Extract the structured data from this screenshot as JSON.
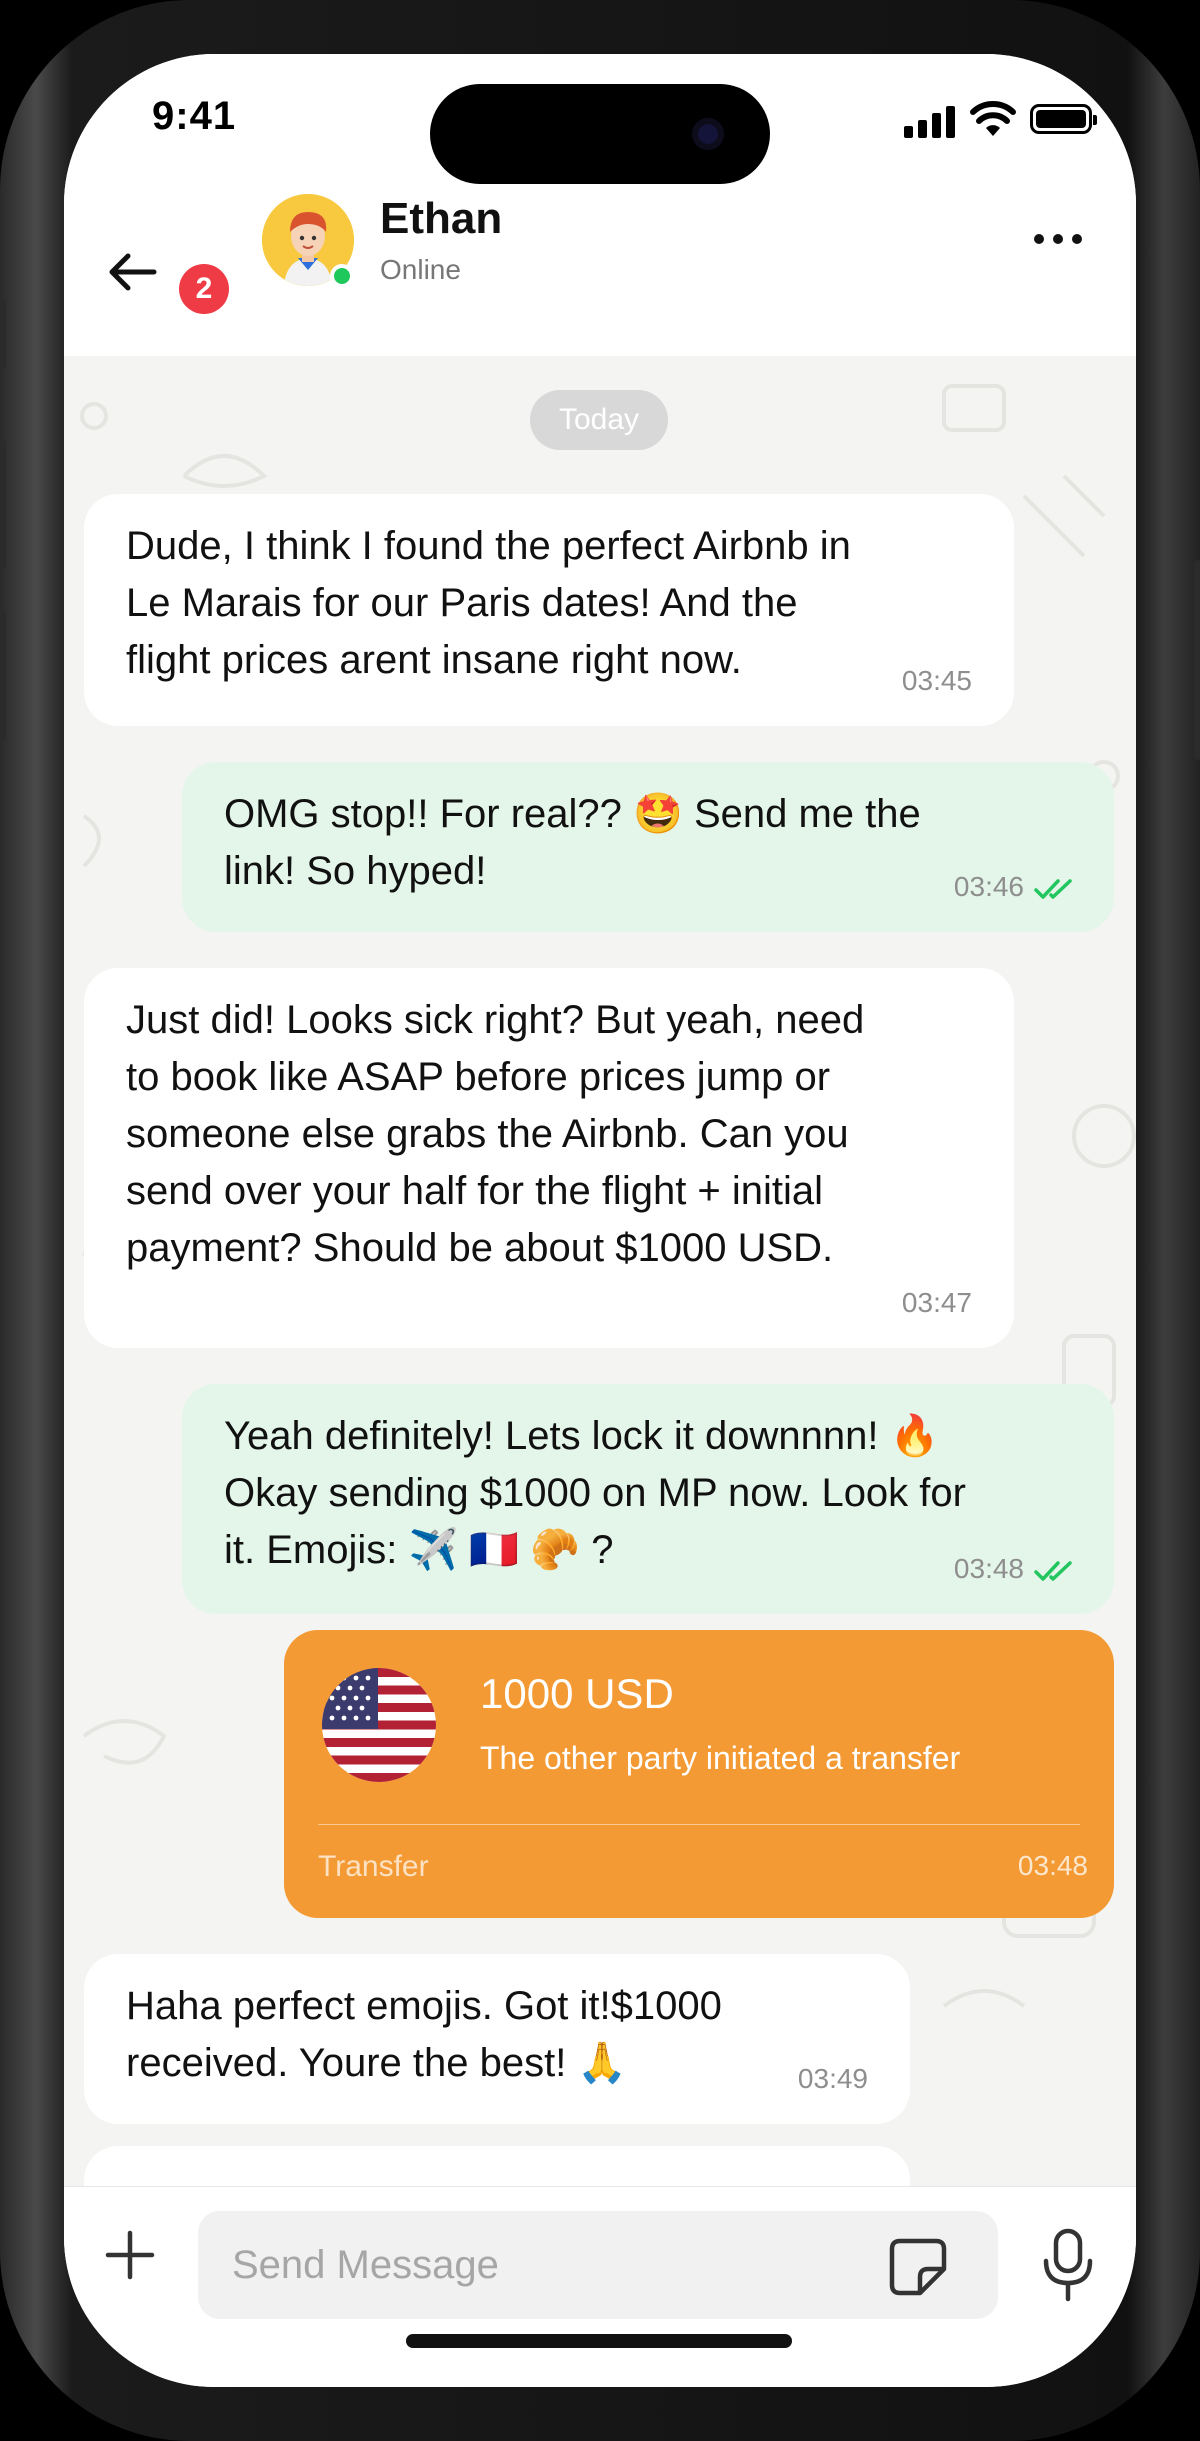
{
  "status_bar": {
    "time": "9:41"
  },
  "header": {
    "back_icon": "arrow-left-icon",
    "unread_count": "2",
    "contact_name": "Ethan",
    "contact_status": "Online",
    "more_icon": "more-horizontal-icon"
  },
  "chat": {
    "date_separator": "Today",
    "messages": [
      {
        "direction": "incoming",
        "text": "Dude, I think I found the perfect Airbnb in\nLe Marais for our Paris dates! And the\nflight prices arent insane right now.",
        "time": "03:45"
      },
      {
        "direction": "outgoing",
        "text": "OMG stop!! For real?? 🤩 Send me the\nlink! So hyped!",
        "time": "03:46",
        "read": true
      },
      {
        "direction": "incoming",
        "text": "Just did! Looks sick right? But yeah, need\nto book like ASAP before prices jump or\nsomeone else grabs the Airbnb. Can you\nsend over your half for the flight + initial\npayment? Should be about $1000 USD.",
        "time": "03:47"
      },
      {
        "direction": "outgoing",
        "text": "Yeah definitely! Lets lock it downnnn! 🔥\nOkay sending $1000 on MP now. Look for\nit. Emojis: ✈️ 🇫🇷 🥐 ?",
        "time": "03:48",
        "read": true
      },
      {
        "direction": "incoming",
        "text": "Haha perfect emojis. Got it!$1000\nreceived. Youre the best! 🙏",
        "time": "03:49"
      }
    ],
    "transfer": {
      "amount": "1000 USD",
      "description": "The other party initiated a transfer",
      "label": "Transfer",
      "time": "03:48",
      "card_color": "#f49a34",
      "flag_icon": "us-flag-icon"
    }
  },
  "composer": {
    "placeholder": "Send Message",
    "plus_icon": "plus-icon",
    "sticker_icon": "sticker-icon",
    "mic_icon": "microphone-icon"
  },
  "colors": {
    "incoming_bubble": "#ffffff",
    "outgoing_bubble": "#e3f6e9",
    "read_ticks": "#22c55e",
    "badge": "#ef3b46",
    "online": "#1fc85a"
  }
}
